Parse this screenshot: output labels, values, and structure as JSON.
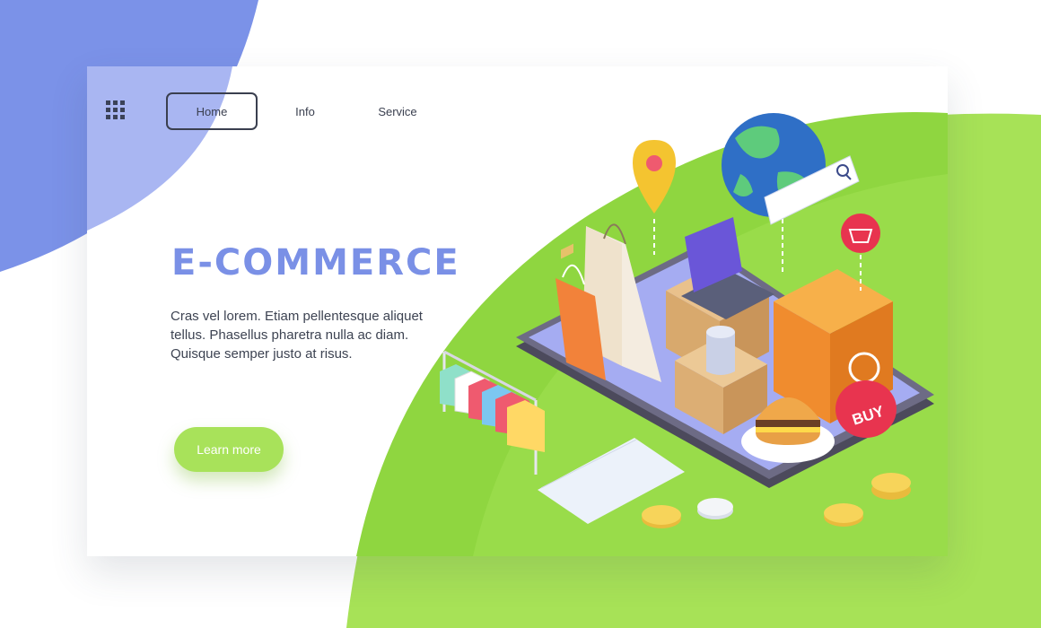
{
  "nav": {
    "menu_icon": "grid-menu-icon",
    "items": [
      {
        "label": "Home",
        "active": true
      },
      {
        "label": "Info",
        "active": false
      },
      {
        "label": "Service",
        "active": false
      }
    ]
  },
  "hero": {
    "title": "E-COMMERCE",
    "description": "Cras vel lorem. Etiam pellentesque aliquet tellus. Phasellus pharetra nulla ac diam. Quisque semper justo at risus.",
    "cta_label": "Learn more"
  },
  "illustration": {
    "buy_badge": "BUY",
    "icons": [
      "location-pin-icon",
      "globe-icon",
      "search-bar-icon",
      "shopping-basket-icon",
      "smartphone-icon",
      "shopping-bag-icon",
      "tablet-icon",
      "cardboard-box-icon",
      "delivery-bag-icon",
      "burger-icon",
      "clothes-rack-icon",
      "credit-card-icon",
      "coin-icon"
    ]
  },
  "colors": {
    "accent_blue": "#7a90e6",
    "accent_green": "#a8e25a",
    "background_green": "#8fd640",
    "background_blue": "#7b92e8",
    "text_dark": "#3d4352"
  }
}
